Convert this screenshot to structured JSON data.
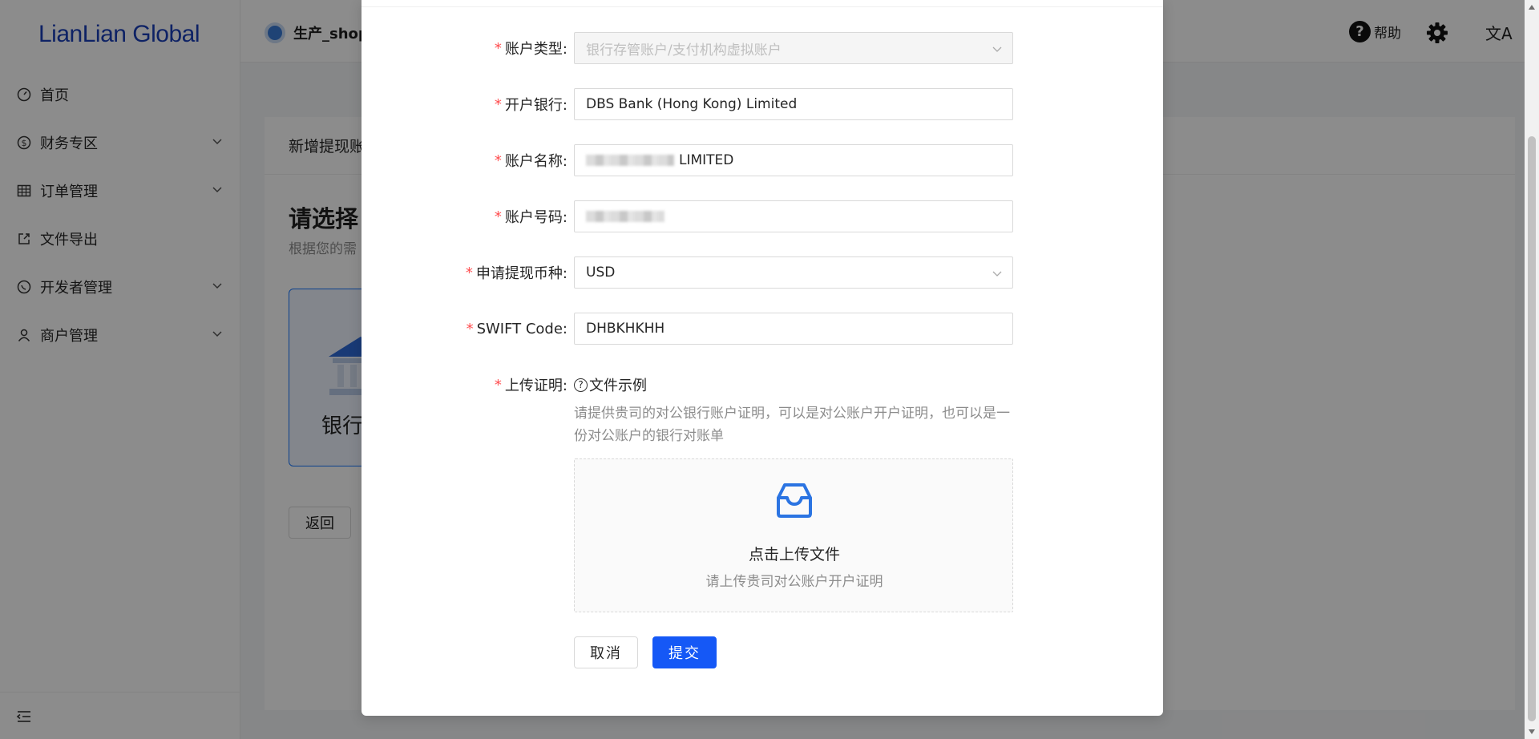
{
  "app": {
    "logo": "LianLian Global",
    "shop_name": "生产_shop",
    "help_label": "帮助",
    "lang_glyph": "文A"
  },
  "sidebar": {
    "items": [
      {
        "label": "首页",
        "icon": "dashboard-icon",
        "has_children": false
      },
      {
        "label": "财务专区",
        "icon": "dollar-circle-icon",
        "has_children": true
      },
      {
        "label": "订单管理",
        "icon": "table-icon",
        "has_children": true
      },
      {
        "label": "文件导出",
        "icon": "export-icon",
        "has_children": false
      },
      {
        "label": "开发者管理",
        "icon": "chat-icon",
        "has_children": true
      },
      {
        "label": "商户管理",
        "icon": "user-icon",
        "has_children": true
      }
    ]
  },
  "page": {
    "breadcrumb": "新增提现账",
    "title": "请选择",
    "subtitle": "根据您的需",
    "bank_option_label": "银行",
    "back_label": "返回"
  },
  "modal": {
    "fields": {
      "account_type": {
        "label": "账户类型:",
        "value": "银行存管账户/支付机构虚拟账户"
      },
      "bank": {
        "label": "开户银行:",
        "value": "DBS Bank (Hong Kong) Limited"
      },
      "account_name": {
        "label": "账户名称:",
        "value": "LIMITED"
      },
      "account_number": {
        "label": "账户号码:",
        "value": ""
      },
      "currency": {
        "label": "申请提现币种:",
        "value": "USD"
      },
      "swift": {
        "label": "SWIFT Code:",
        "value": "DHBKHKHH"
      }
    },
    "upload": {
      "label": "上传证明:",
      "example_label": "文件示例",
      "hint": "请提供贵司的对公银行账户证明，可以是对公账户开户证明，也可以是一份对公账户的银行对账单",
      "dropzone_title": "点击上传文件",
      "dropzone_sub": "请上传贵司对公账户开户证明"
    },
    "cancel_label": "取消",
    "submit_label": "提交"
  },
  "colors": {
    "primary": "#1558f6",
    "required": "#ff4d4f",
    "logo": "#1a3fb8"
  }
}
